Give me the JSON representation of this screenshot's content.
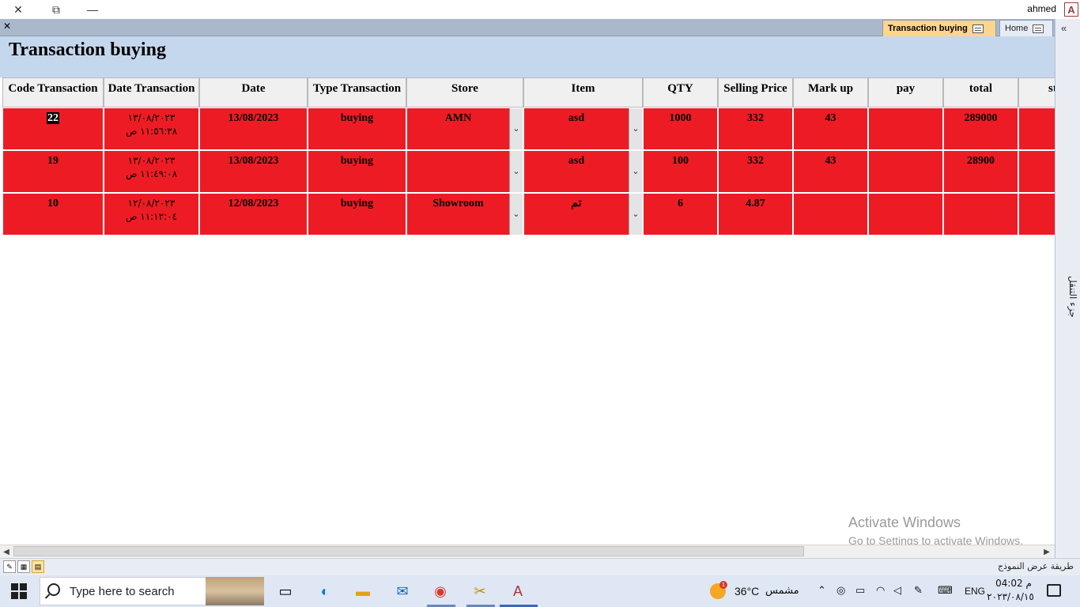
{
  "app": {
    "user_name": "ahmed",
    "logo_letter": "A",
    "win_controls": {
      "close": "✕",
      "restore": "⧉",
      "minimize": "—"
    }
  },
  "tabs": {
    "close_doc": "✕",
    "active": "Transaction buying",
    "home": "Home"
  },
  "form": {
    "title": "Transaction buying"
  },
  "grid": {
    "columns": [
      "Code Transaction",
      "Date Transaction",
      "Date",
      "Type Transaction",
      "Store",
      "Item",
      "QTY",
      "Selling Price",
      "Mark up",
      "pay",
      "total",
      "st"
    ],
    "rows": [
      {
        "code": "22",
        "date_line1": "١٣/٠٨/٢٠٢٣",
        "date_line2": "١١:٥٦:٣٨ ص",
        "date": "13/08/2023",
        "type": "buying",
        "store": "AMN",
        "item": "asd",
        "qty": "1000",
        "selling_price": "332",
        "markup": "43",
        "pay": "",
        "total": "289000"
      },
      {
        "code": "19",
        "date_line1": "١٣/٠٨/٢٠٢٣",
        "date_line2": "١١:٤٩:٠٨ ص",
        "date": "13/08/2023",
        "type": "buying",
        "store": "",
        "item": "asd",
        "qty": "100",
        "selling_price": "332",
        "markup": "43",
        "pay": "",
        "total": "28900"
      },
      {
        "code": "10",
        "date_line1": "١٢/٠٨/٢٠٢٣",
        "date_line2": "١١:١٢:٠٤ ص",
        "date": "12/08/2023",
        "type": "buying",
        "store": "Showroom",
        "item": "تم",
        "qty": "6",
        "selling_price": "4.87",
        "markup": "",
        "pay": "",
        "total": ""
      }
    ],
    "row_color": "#ed1c24",
    "combo_glyph": "⌄"
  },
  "nav_pane": {
    "toggle": "«",
    "label": "جزء التنقل"
  },
  "watermark": {
    "line1": "Activate Windows",
    "line2": "Go to Settings to activate Windows."
  },
  "status_bar": {
    "text": "طريقة عرض النموذج"
  },
  "taskbar": {
    "search_placeholder": "Type here to search",
    "weather_temp": "36°C",
    "weather_condition": "مشمس",
    "weather_badge": "1",
    "language": "ENG",
    "time": "م 04:02",
    "date": "٢٠٢٣/٠٨/١٥"
  }
}
